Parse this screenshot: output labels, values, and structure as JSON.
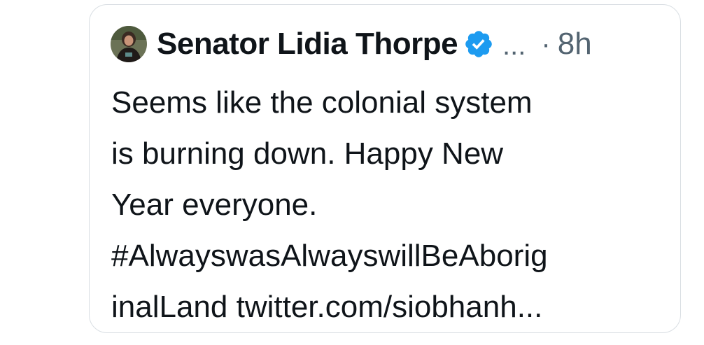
{
  "tweet": {
    "author": {
      "name": "Senator Lidia Thorpe",
      "verified_icon": "verified-badge-icon",
      "ellipsis": "...",
      "separator": "·",
      "time": "8h"
    },
    "lines": [
      "Seems like the colonial system",
      "is burning down. Happy New",
      "Year everyone.",
      "#AlwayswasAlwayswillBeAborig",
      "inalLand twitter.com/siobhanh..."
    ]
  },
  "colors": {
    "text_primary": "#0f1419",
    "text_secondary": "#536471",
    "verified_blue": "#1d9bf0",
    "border": "#d9dee3"
  }
}
